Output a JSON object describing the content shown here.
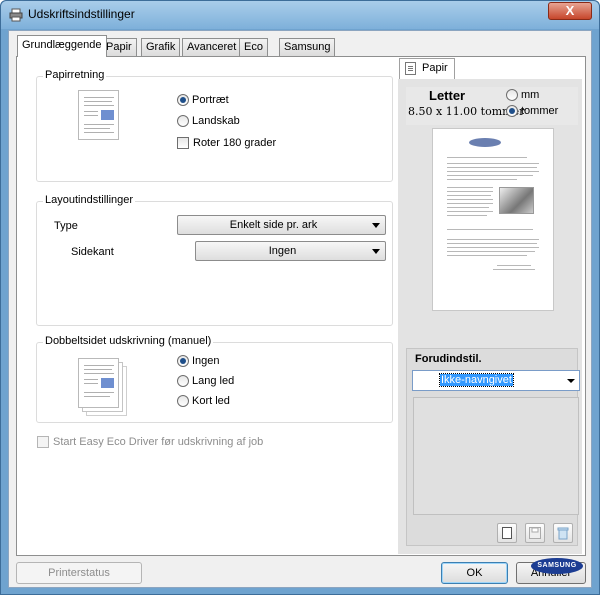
{
  "window": {
    "title": "Udskriftsindstillinger",
    "close_label": "X"
  },
  "tabs": [
    {
      "label": "Grundlæggende",
      "active": true
    },
    {
      "label": "Papir"
    },
    {
      "label": "Grafik"
    },
    {
      "label": "Avanceret"
    },
    {
      "label": "Eco"
    },
    {
      "label": "Samsung"
    }
  ],
  "orientation": {
    "legend": "Papirretning",
    "portrait": "Portræt",
    "landscape": "Landskab",
    "rotate": "Roter 180 grader",
    "selected": "Portræt"
  },
  "layout": {
    "legend": "Layoutindstillinger",
    "type_label": "Type",
    "type_value": "Enkelt side pr. ark",
    "border_label": "Sidekant",
    "border_value": "Ingen"
  },
  "duplex": {
    "legend": "Dobbeltsidet udskrivning (manuel)",
    "none": "Ingen",
    "long": "Lang led",
    "short": "Kort led",
    "selected": "Ingen"
  },
  "eco_check": "Start Easy Eco Driver før udskrivning af job",
  "preview": {
    "tab_label": "Papir",
    "paper_name": "Letter",
    "dimensions": "8.50 x 11.00 tommer",
    "unit_mm": "mm",
    "unit_inch": "tommer",
    "unit_selected": "tommer"
  },
  "presets": {
    "title": "Forudindstil.",
    "value": "Ikke-navngivet"
  },
  "buttons": {
    "printer_status": "Printerstatus",
    "ok": "OK",
    "cancel": "Annuller"
  },
  "brand": {
    "logo_text": "SAMSUNG",
    "preview_logo_text": "SAMSUNG"
  },
  "colors": {
    "accent": "#3399ff",
    "titlebar": "#7eb0da",
    "close": "#c6462b",
    "samsung_blue": "#1c3d93"
  }
}
